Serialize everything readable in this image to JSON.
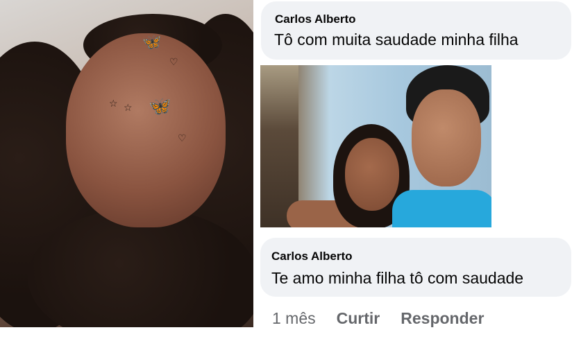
{
  "comments": [
    {
      "author": "Carlos Alberto",
      "text": "Tô com muita saudade minha filha"
    },
    {
      "author": "Carlos Alberto",
      "text": "Te amo minha filha tô com saudade"
    }
  ],
  "actions": {
    "time": "1 mês",
    "like_label": "Curtir",
    "reply_label": "Responder"
  },
  "stickers": {
    "butterfly": "🦋",
    "heart": "♡",
    "star": "☆"
  },
  "colors": {
    "bubble_bg": "#f0f2f5",
    "meta_text": "#65676b",
    "sticker_pink": "#e84bc8"
  }
}
